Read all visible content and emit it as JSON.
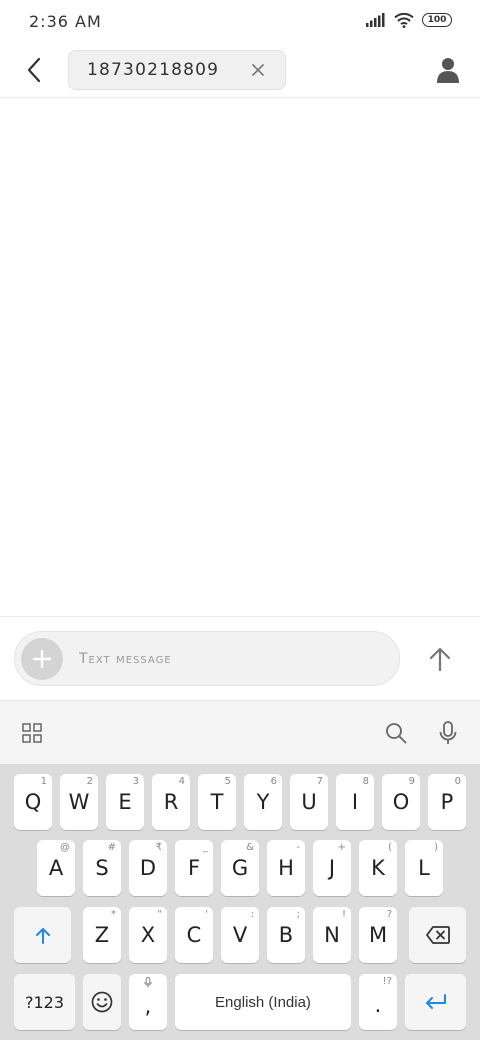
{
  "status_bar": {
    "time": "2:36 AM",
    "battery": "100"
  },
  "header": {
    "recipient": "18730218809"
  },
  "compose": {
    "placeholder": "Text message"
  },
  "keyboard": {
    "row1": [
      {
        "key": "Q",
        "sub": "1"
      },
      {
        "key": "W",
        "sub": "2"
      },
      {
        "key": "E",
        "sub": "3"
      },
      {
        "key": "R",
        "sub": "4"
      },
      {
        "key": "T",
        "sub": "5"
      },
      {
        "key": "Y",
        "sub": "6"
      },
      {
        "key": "U",
        "sub": "7"
      },
      {
        "key": "I",
        "sub": "8"
      },
      {
        "key": "O",
        "sub": "9"
      },
      {
        "key": "P",
        "sub": "0"
      }
    ],
    "row2": [
      {
        "key": "A",
        "sub": "@"
      },
      {
        "key": "S",
        "sub": "#"
      },
      {
        "key": "D",
        "sub": "₹"
      },
      {
        "key": "F",
        "sub": "_"
      },
      {
        "key": "G",
        "sub": "&"
      },
      {
        "key": "H",
        "sub": "-"
      },
      {
        "key": "J",
        "sub": "+"
      },
      {
        "key": "K",
        "sub": "("
      },
      {
        "key": "L",
        "sub": ")"
      }
    ],
    "row3": [
      {
        "key": "Z",
        "sub": "*"
      },
      {
        "key": "X",
        "sub": "\""
      },
      {
        "key": "C",
        "sub": "'"
      },
      {
        "key": "V",
        "sub": ":"
      },
      {
        "key": "B",
        "sub": ";"
      },
      {
        "key": "N",
        "sub": "!"
      },
      {
        "key": "M",
        "sub": "?"
      }
    ],
    "symbols_label": "?123",
    "comma": ",",
    "space_label": "English (India)",
    "period": ".",
    "period_sub": "!?"
  },
  "icons": {
    "back": "chevron-left-icon",
    "clear": "close-icon",
    "contact": "person-icon",
    "add": "plus-icon",
    "send": "arrow-up-icon",
    "apps": "grid-icon",
    "search": "search-icon",
    "mic": "microphone-icon",
    "shift": "shift-icon",
    "backspace": "backspace-icon",
    "emoji": "emoji-icon",
    "enter": "enter-icon"
  },
  "colors": {
    "accent": "#1e88e5"
  }
}
